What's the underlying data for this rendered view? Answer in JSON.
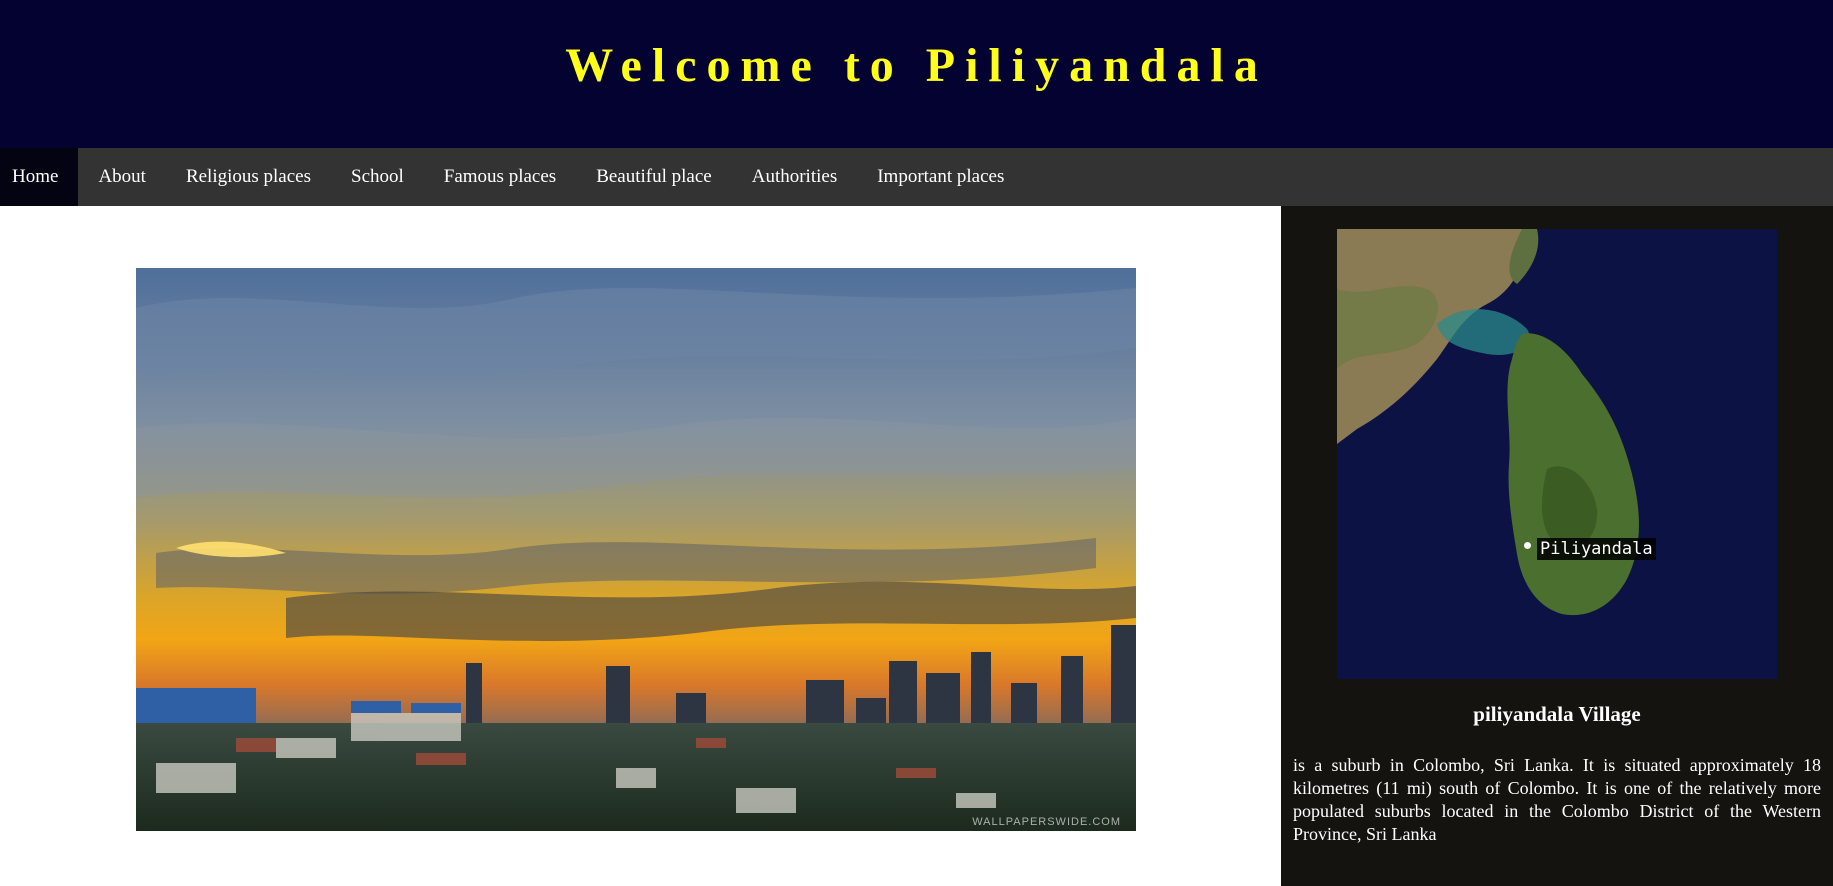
{
  "header": {
    "title": "Welcome to Piliyandala"
  },
  "nav": {
    "items": [
      {
        "label": "Home",
        "active": true
      },
      {
        "label": "About"
      },
      {
        "label": "Religious places"
      },
      {
        "label": "School"
      },
      {
        "label": "Famous places"
      },
      {
        "label": "Beautiful place"
      },
      {
        "label": "Authorities"
      },
      {
        "label": "Important places"
      }
    ]
  },
  "hero": {
    "watermark": "WALLPAPERSWIDE.COM"
  },
  "sidebar": {
    "map_label": "Piliyandala",
    "heading": "piliyandala Village",
    "description": "is a suburb in Colombo, Sri Lanka. It is situated approximately 18 kilometres (11 mi) south of Colombo. It is one of the relatively more populated suburbs located in the Colombo District of the Western Province, Sri Lanka"
  },
  "colors": {
    "header_bg": "#030230",
    "title": "#ffff1a",
    "nav_bg": "#333333",
    "nav_active_bg": "#030312",
    "sidebar_bg": "#141310"
  }
}
